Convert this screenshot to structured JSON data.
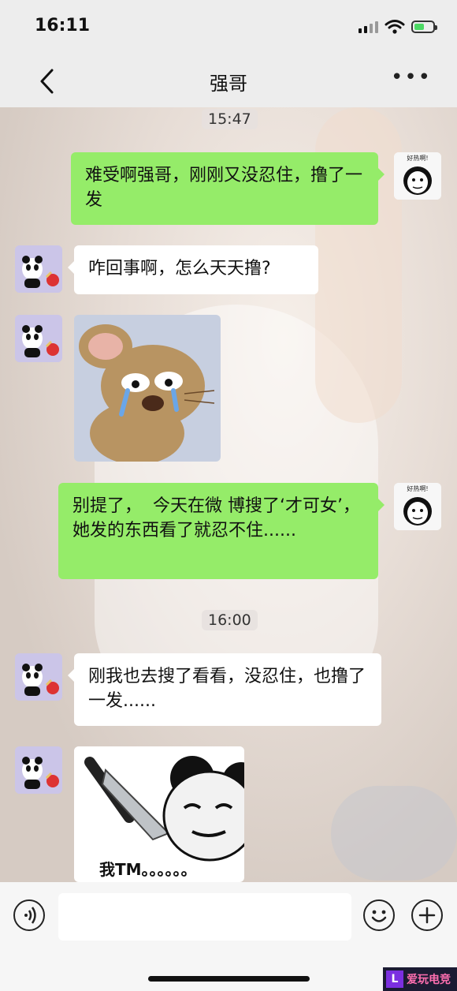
{
  "status_bar": {
    "time": "16:11"
  },
  "nav": {
    "title": "强哥",
    "more": "•••"
  },
  "messages": {
    "ts1": "15:47",
    "m1": "难受啊强哥，刚刚又没忍住，撸了一发",
    "m2": "咋回事啊，怎么天天撸?",
    "m4": "别提了，  今天在微 博搜了‘才可女’，她发的东西看了就忍不住......",
    "ts2": "16:00",
    "m5": "刚我也去搜了看看，没忍住，也撸了一发......",
    "sticker_text": "我TM。。。。。。"
  },
  "avatar_me_caption": "好热啊!",
  "watermark": {
    "text": "爱玩电竞"
  },
  "colors": {
    "my_bubble": "#95ec69",
    "their_bubble": "#ffffff",
    "bg": "#ededed"
  },
  "icons": [
    "chevron-left-icon",
    "more-icon",
    "voice-icon",
    "emoji-icon",
    "add-icon"
  ]
}
